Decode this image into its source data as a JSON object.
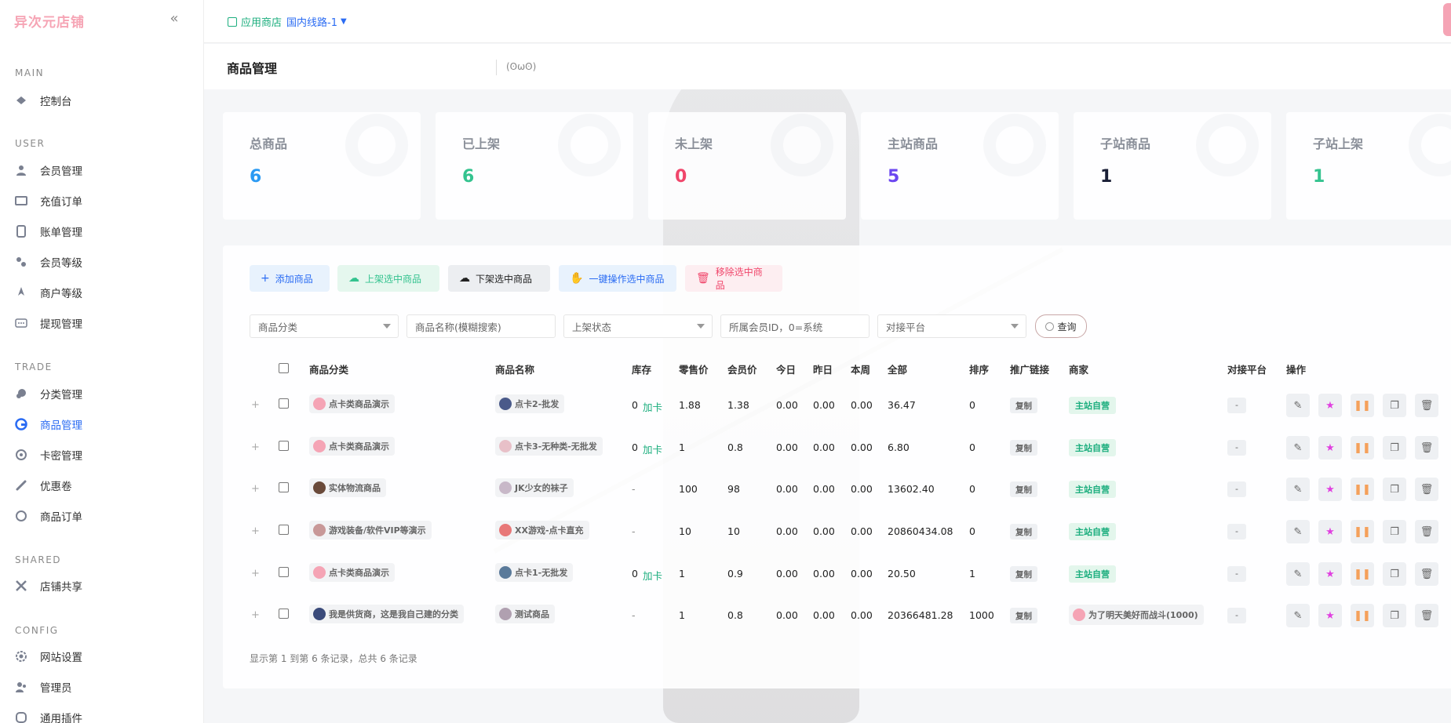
{
  "brand": "异次元店铺",
  "topbar": {
    "store_label": "应用商店",
    "route_label": "国内线路-1"
  },
  "nav": {
    "sections": [
      "MAIN",
      "USER",
      "TRADE",
      "SHARED",
      "CONFIG"
    ],
    "items": [
      "控制台",
      "会员管理",
      "充值订单",
      "账单管理",
      "会员等级",
      "商户等级",
      "提现管理",
      "分类管理",
      "商品管理",
      "卡密管理",
      "优惠卷",
      "商品订单",
      "店铺共享",
      "网站设置",
      "管理员",
      "通用插件"
    ]
  },
  "page": {
    "title": "商品管理",
    "subtitle": "(ʘωʘ)"
  },
  "stats": [
    {
      "label": "总商品",
      "value": "6",
      "color": "#2b9af3"
    },
    {
      "label": "已上架",
      "value": "6",
      "color": "#34c38f"
    },
    {
      "label": "未上架",
      "value": "0",
      "color": "#f0466b"
    },
    {
      "label": "主站商品",
      "value": "5",
      "color": "#6b46f0"
    },
    {
      "label": "子站商品",
      "value": "1",
      "color": "#1a1f36"
    },
    {
      "label": "子站上架",
      "value": "1",
      "color": "#34c38f"
    }
  ],
  "toolbar": {
    "add": "添加商品",
    "shelf_on": "上架选中商品",
    "shelf_off": "下架选中商品",
    "batch": "一键操作选中商品",
    "remove": "移除选中商品"
  },
  "filters": {
    "category": "商品分类",
    "name": "商品名称(模糊搜索)",
    "status": "上架状态",
    "member": "所属会员ID，0=系统",
    "platform": "对接平台",
    "query": "查询"
  },
  "table": {
    "headers": [
      "商品分类",
      "商品名称",
      "库存",
      "零售价",
      "会员价",
      "今日",
      "昨日",
      "本周",
      "全部",
      "排序",
      "推广链接",
      "商家",
      "对接平台",
      "操作"
    ],
    "rows": [
      {
        "category": "点卡类商品演示",
        "name": "点卡2-批发",
        "stock": "0",
        "card": "加卡",
        "price": "1.88",
        "member_price": "1.38",
        "today": "0.00",
        "yesterday": "0.00",
        "week": "0.00",
        "total": "36.47",
        "sort": "0",
        "link": "复制",
        "merchant": "主站自营",
        "platform": "-"
      },
      {
        "category": "点卡类商品演示",
        "name": "点卡3-无种类-无批发",
        "stock": "0",
        "card": "加卡",
        "price": "1",
        "member_price": "0.8",
        "today": "0.00",
        "yesterday": "0.00",
        "week": "0.00",
        "total": "6.80",
        "sort": "0",
        "link": "复制",
        "merchant": "主站自营",
        "platform": "-"
      },
      {
        "category": "实体物流商品",
        "name": "JK少女的袜子",
        "stock": "-",
        "card": "",
        "price": "100",
        "member_price": "98",
        "today": "0.00",
        "yesterday": "0.00",
        "week": "0.00",
        "total": "13602.40",
        "sort": "0",
        "link": "复制",
        "merchant": "主站自营",
        "platform": "-"
      },
      {
        "category": "游戏装备/软件VIP等演示",
        "name": "XX游戏-点卡直充",
        "stock": "-",
        "card": "",
        "price": "10",
        "member_price": "10",
        "today": "0.00",
        "yesterday": "0.00",
        "week": "0.00",
        "total": "20860434.08",
        "sort": "0",
        "link": "复制",
        "merchant": "主站自营",
        "platform": "-"
      },
      {
        "category": "点卡类商品演示",
        "name": "点卡1-无批发",
        "stock": "0",
        "card": "加卡",
        "price": "1",
        "member_price": "0.9",
        "today": "0.00",
        "yesterday": "0.00",
        "week": "0.00",
        "total": "20.50",
        "sort": "1",
        "link": "复制",
        "merchant": "主站自营",
        "platform": "-"
      },
      {
        "category": "我是供货商，这是我自己建的分类",
        "name": "测试商品",
        "stock": "-",
        "card": "",
        "price": "1",
        "member_price": "0.8",
        "today": "0.00",
        "yesterday": "0.00",
        "week": "0.00",
        "total": "20366481.28",
        "sort": "1000",
        "link": "复制",
        "merchant": "为了明天美好而战斗(1000)",
        "platform": "-"
      }
    ]
  },
  "footer": "显示第 1 到第 6 条记录，总共 6 条记录"
}
